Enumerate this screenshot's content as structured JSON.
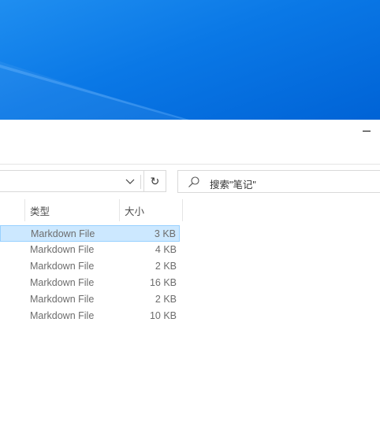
{
  "desktop": {
    "accent": "#0a78e6"
  },
  "window": {
    "minimize_label": "—"
  },
  "toolbar": {
    "refresh_icon": "↻",
    "search_placeholder": "搜索\"笔记\""
  },
  "columns": {
    "type": "类型",
    "size": "大小"
  },
  "files": [
    {
      "type": "Markdown File",
      "size": "3 KB",
      "selected": true
    },
    {
      "type": "Markdown File",
      "size": "4 KB"
    },
    {
      "type": "Markdown File",
      "size": "2 KB"
    },
    {
      "type": "Markdown File",
      "size": "16 KB"
    },
    {
      "type": "Markdown File",
      "size": "2 KB"
    },
    {
      "type": "Markdown File",
      "size": "10 KB"
    }
  ]
}
